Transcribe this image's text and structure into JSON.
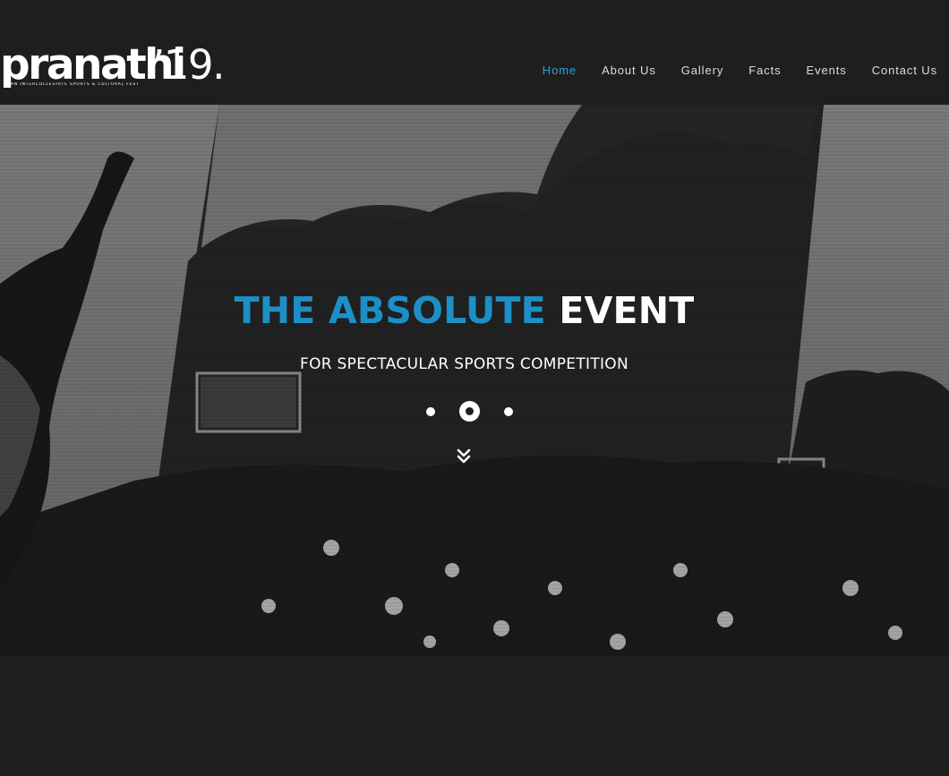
{
  "brand": {
    "name": "pranathi",
    "year": "’19.",
    "tagline": "AN INTERCOLLEGIATE SPORTS & CULTURAL FEST"
  },
  "nav": {
    "items": [
      {
        "label": "Home",
        "active": true
      },
      {
        "label": "About Us",
        "active": false
      },
      {
        "label": "Gallery",
        "active": false
      },
      {
        "label": "Facts",
        "active": false
      },
      {
        "label": "Events",
        "active": false
      },
      {
        "label": "Contact Us",
        "active": false
      }
    ]
  },
  "hero": {
    "headline_accent": "THE ABSOLUTE",
    "headline_plain": "EVENT",
    "subheadline": "FOR SPECTACULAR SPORTS COMPETITION",
    "slide_count": 3,
    "active_slide": 2,
    "scroll_icon": "double-chevron-down-icon"
  },
  "colors": {
    "accent": "#1c8fc7",
    "nav_active": "#2aa5d9",
    "background": "#1f1f1f",
    "text": "#ffffff"
  }
}
